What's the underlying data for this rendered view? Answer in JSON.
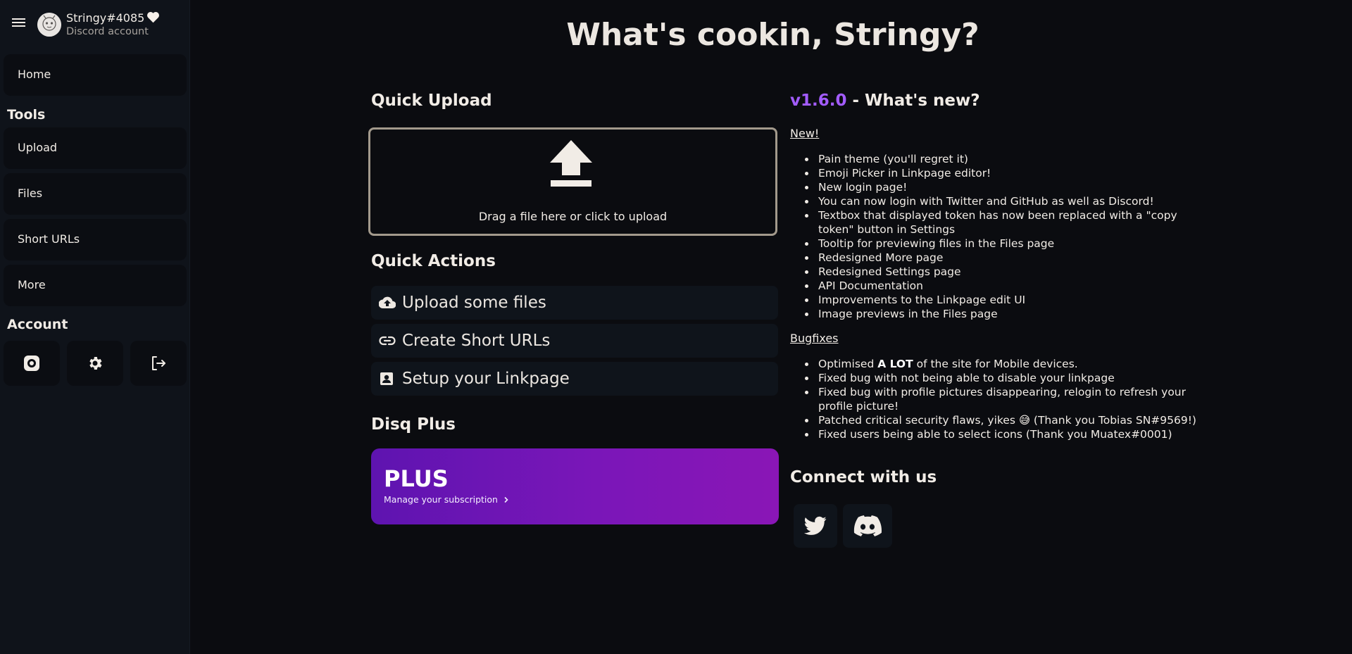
{
  "user": {
    "name": "Stringy#4085",
    "account_type": "Discord account"
  },
  "sidebar": {
    "home_label": "Home",
    "tools_title": "Tools",
    "tools": [
      {
        "label": "Upload"
      },
      {
        "label": "Files"
      },
      {
        "label": "Short URLs"
      },
      {
        "label": "More"
      }
    ],
    "account_title": "Account",
    "account_icons": [
      "camera-shutter-icon",
      "gear-icon",
      "logout-icon"
    ]
  },
  "main": {
    "title": "What's cookin, Stringy?",
    "quick_upload": {
      "title": "Quick Upload",
      "drop_text": "Drag a file here or click to upload"
    },
    "quick_actions": {
      "title": "Quick Actions",
      "items": [
        {
          "label": "Upload some files",
          "icon": "cloud-upload-icon"
        },
        {
          "label": "Create Short URLs",
          "icon": "link-icon"
        },
        {
          "label": "Setup your Linkpage",
          "icon": "contact-card-icon"
        }
      ]
    },
    "plus": {
      "section_title": "Disq Plus",
      "card_title": "PLUS",
      "card_subtitle": "Manage your subscription"
    }
  },
  "changelog": {
    "version": "v1.6.0",
    "title_suffix": " - What's new?",
    "new_heading": "New!",
    "new_items": [
      "Pain theme (you'll regret it)",
      "Emoji Picker in Linkpage editor!",
      "New login page!",
      "You can now login with Twitter and GitHub as well as Discord!",
      "Textbox that displayed token has now been replaced with a \"copy token\" button in Settings",
      "Tooltip for previewing files in the Files page",
      "Redesigned More page",
      "Redesigned Settings page",
      "API Documentation",
      "Improvements to the Linkpage edit UI",
      "Image previews in the Files page"
    ],
    "bugfix_heading": "Bugfixes",
    "bugfix_items": {
      "optimised_pre": "Optimised ",
      "optimised_bold": "A LOT",
      "optimised_post": " of the site for Mobile devices.",
      "linkpage": "Fixed bug with not being able to disable your linkpage",
      "profile": "Fixed bug with profile pictures disappearing, relogin to refresh your profile picture!",
      "security": "Patched critical security flaws, yikes 😅 (Thank you Tobias SN#9569!)",
      "icons": "Fixed users being able to select icons (Thank you Muatex#0001)"
    }
  },
  "connect": {
    "title": "Connect with us",
    "links": [
      "twitter-icon",
      "discord-icon"
    ]
  },
  "colors": {
    "background": "#0b0c10",
    "sidebar": "#0f131a",
    "accent_version": "#a35cff",
    "plus_gradient_start": "#5e14b0",
    "plus_gradient_end": "#8a16b6"
  }
}
